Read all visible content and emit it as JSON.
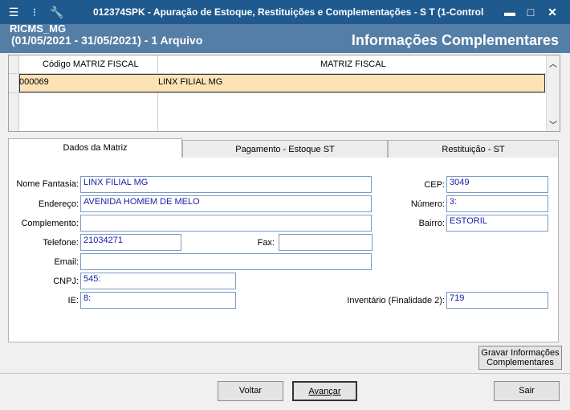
{
  "window": {
    "title": "012374SPK - Apuração de Estoque, Restituições e Complementações - S T (1-Control",
    "min_glyph": "▬",
    "max_glyph": "□",
    "close_glyph": "✕"
  },
  "header": {
    "module": "RICMS_MG",
    "period": "(01/05/2021 - 31/05/2021) - 1 Arquivo",
    "section_title": "Informações Complementares"
  },
  "grid": {
    "columns": [
      "Código MATRIZ FISCAL",
      "MATRIZ FISCAL"
    ],
    "rows": [
      {
        "code": "000069",
        "name": "LINX FILIAL MG"
      }
    ]
  },
  "tabs": [
    "Dados da Matriz",
    "Pagamento - Estoque ST",
    "Restituição - ST"
  ],
  "form": {
    "nome_fantasia_label": "Nome Fantasia:",
    "nome_fantasia": "LINX FILIAL MG",
    "endereco_label": "Endereço:",
    "endereco": "AVENIDA HOMEM DE MELO",
    "complemento_label": "Complemento:",
    "complemento": "",
    "telefone_label": "Telefone:",
    "telefone": "21034271",
    "fax_label": "Fax:",
    "fax": "",
    "email_label": "Email:",
    "email": "",
    "cnpj_label": "CNPJ:",
    "cnpj": "545:",
    "ie_label": "IE:",
    "ie": "8:",
    "cep_label": "CEP:",
    "cep": "3049",
    "numero_label": "Número:",
    "numero": "3:",
    "bairro_label": "Bairro:",
    "bairro": "ESTORIL",
    "inventario_label": "Inventário (Finalidade 2):",
    "inventario": "719"
  },
  "buttons": {
    "gravar_line1": "Gravar Informações",
    "gravar_line2": "Complementares",
    "voltar": "Voltar",
    "avancar": "Avançar",
    "sair": "Sair"
  },
  "colors": {
    "titlebar": "#1f5a8e",
    "header": "#557ea6",
    "selected_row": "#fbe3b6",
    "input_text": "#1a1aa8"
  }
}
